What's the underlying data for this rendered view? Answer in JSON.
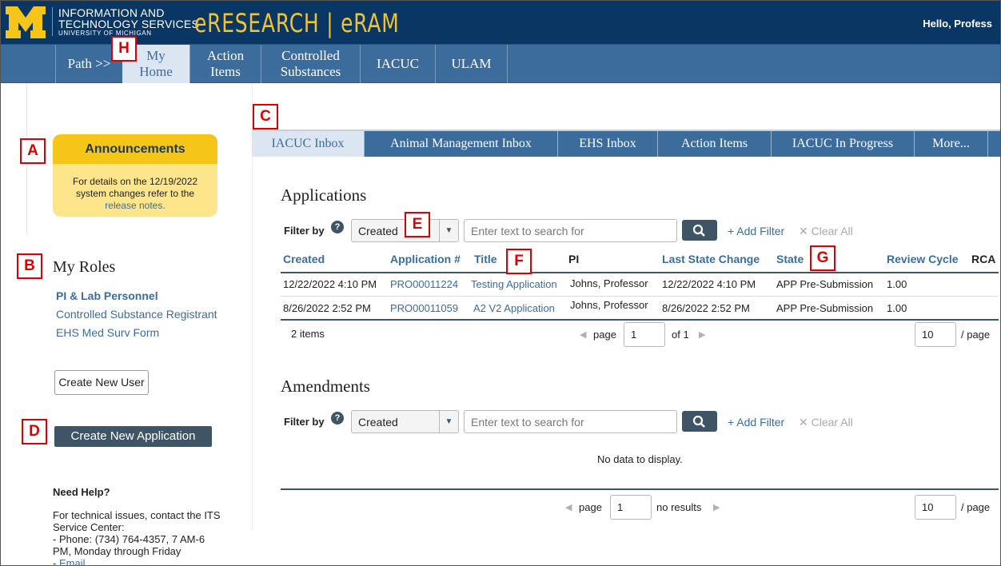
{
  "header": {
    "its_line1": "INFORMATION AND",
    "its_line2": "TECHNOLOGY SERVICES",
    "its_line3": "UNIVERSITY OF MICHIGAN",
    "app_title": "eRESEARCH | eRAM",
    "greeting": "Hello, Profess"
  },
  "nav": {
    "path_label": "Path >>",
    "items": [
      {
        "line1": "My",
        "line2": "Home"
      },
      {
        "line1": "Action",
        "line2": "Items"
      },
      {
        "line1": "Controlled",
        "line2": "Substances"
      },
      {
        "line1": "IACUC"
      },
      {
        "line1": "ULAM"
      }
    ]
  },
  "markers": [
    "A",
    "B",
    "C",
    "D",
    "E",
    "F",
    "G",
    "H"
  ],
  "announcements": {
    "title": "Announcements",
    "line1": "For details on the 12/19/2022",
    "line2": "system changes refer to the",
    "link": "release notes."
  },
  "roles": {
    "title": "My Roles",
    "items": [
      "PI & Lab Personnel",
      "Controlled Substance Registrant",
      "EHS Med Surv Form"
    ]
  },
  "buttons": {
    "create_user": "Create New User",
    "create_application": "Create New Application"
  },
  "help": {
    "title": "Need Help?",
    "line1": "For technical issues, contact the ITS",
    "line2": "Service Center:",
    "line3": "- Phone: (734) 764-4357, 7 AM-6",
    "line4": "PM, Monday through Friday",
    "line5_prefix": "- ",
    "line5_link": "Email"
  },
  "tabs": [
    "IACUC Inbox",
    "Animal Management Inbox",
    "EHS Inbox",
    "Action Items",
    "IACUC In Progress",
    "More..."
  ],
  "applications": {
    "title": "Applications",
    "filter_label": "Filter by",
    "filter_value": "Created",
    "search_placeholder": "Enter text to search for",
    "add_filter": "+ Add Filter",
    "clear_all": "✕ Clear All",
    "columns": [
      "Created",
      "Application #",
      "Title",
      "PI",
      "Last State Change",
      "State",
      "Review Cycle",
      "RCA"
    ],
    "rows": [
      {
        "created": "12/22/2022 4:10 PM",
        "app_no": "PRO00011224",
        "title": "Testing Application",
        "pi": "Johns, Professor",
        "last_change": "12/22/2022 4:10 PM",
        "state": "APP Pre-Submission",
        "cycle": "1.00"
      },
      {
        "created": "8/26/2022 2:52 PM",
        "app_no": "PRO00011059",
        "title": "A2 V2 Application",
        "pi": "Johns, Professor",
        "last_change": "8/26/2022 2:52 PM",
        "state": "APP Pre-Submission",
        "cycle": "1.00"
      }
    ],
    "item_count": "2 items",
    "page_label": "page",
    "page_value": "1",
    "of_label": "of 1",
    "per_page_value": "10",
    "per_page_label": "/ page"
  },
  "amendments": {
    "title": "Amendments",
    "filter_label": "Filter by",
    "filter_value": "Created",
    "search_placeholder": "Enter text to search for",
    "add_filter": "+ Add Filter",
    "clear_all": "✕ Clear All",
    "empty": "No data to display.",
    "page_label": "page",
    "page_value": "1",
    "results_label": "no results",
    "per_page_value": "10",
    "per_page_label": "/ page"
  },
  "colors": {
    "header_bg": "#0a3663",
    "nav_bg": "#3c6c9c",
    "maize": "#f5c518",
    "dark_button": "#3f5566",
    "marker_red": "#dd0000"
  }
}
